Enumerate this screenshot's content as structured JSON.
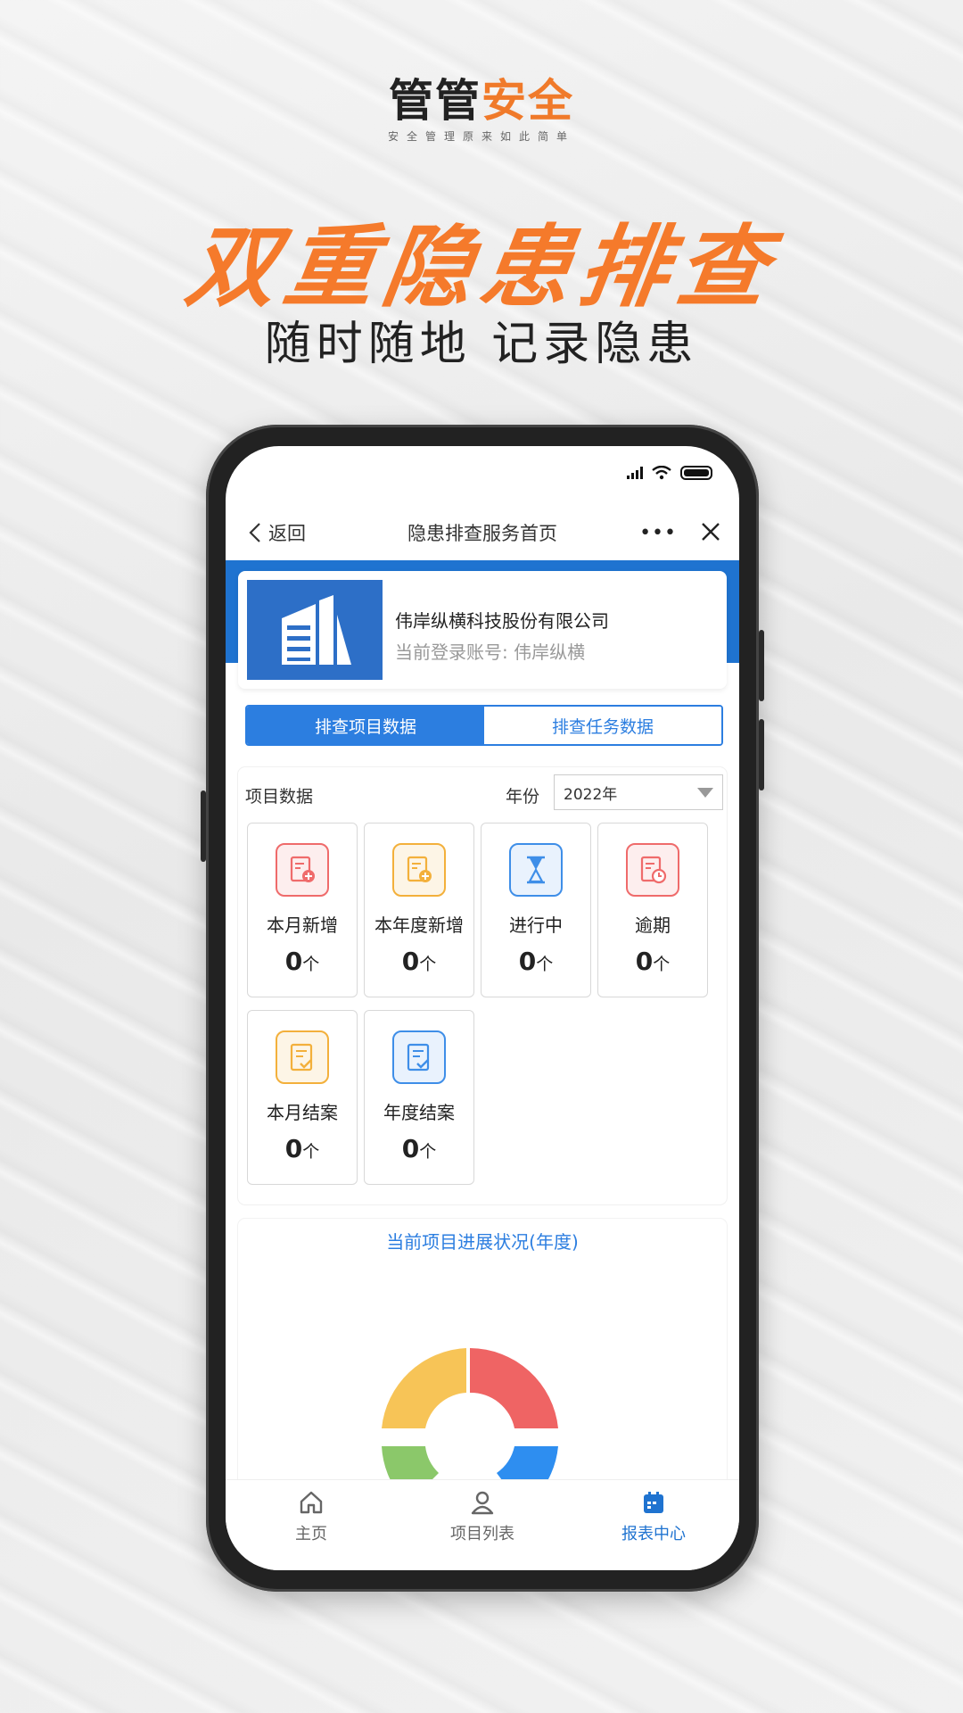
{
  "brand": {
    "logo_part1": "管管",
    "logo_part2": "安全",
    "tagline": "安全管理原来如此简单"
  },
  "headline": "双重隐患排查",
  "subheadline": "随时随地 记录隐患",
  "navbar": {
    "back_label": "返回",
    "title": "隐患排查服务首页",
    "more_label": "•••"
  },
  "company": {
    "name": "伟岸纵横科技股份有限公司",
    "account": "当前登录账号: 伟岸纵横"
  },
  "segments": [
    {
      "label": "排查项目数据",
      "active": true
    },
    {
      "label": "排查任务数据",
      "active": false
    }
  ],
  "project_data": {
    "title": "项目数据",
    "year_label": "年份",
    "year_value": "2022年",
    "stats": [
      {
        "label": "本月新增",
        "value": "0",
        "unit": "个",
        "icon": "file-add-icon",
        "color": "#ef6b6b"
      },
      {
        "label": "本年度新增",
        "value": "0",
        "unit": "个",
        "icon": "file-add-icon",
        "color": "#f3b03b"
      },
      {
        "label": "进行中",
        "value": "0",
        "unit": "个",
        "icon": "hourglass-icon",
        "color": "#3e8ee8"
      },
      {
        "label": "逾期",
        "value": "0",
        "unit": "个",
        "icon": "clock-file-icon",
        "color": "#ef6b6b"
      },
      {
        "label": "本月结案",
        "value": "0",
        "unit": "个",
        "icon": "file-check-icon",
        "color": "#f3b03b"
      },
      {
        "label": "年度结案",
        "value": "0",
        "unit": "个",
        "icon": "file-check-icon",
        "color": "#3e8ee8"
      }
    ]
  },
  "progress": {
    "title": "当前项目进展状况(年度)",
    "donut_colors": [
      "#ef6464",
      "#2e8ef0",
      "#8bc86a",
      "#f7c457"
    ]
  },
  "tabbar": [
    {
      "label": "主页",
      "icon": "home-icon",
      "active": false
    },
    {
      "label": "项目列表",
      "icon": "user-icon",
      "active": false
    },
    {
      "label": "报表中心",
      "icon": "calendar-icon",
      "active": true
    }
  ]
}
